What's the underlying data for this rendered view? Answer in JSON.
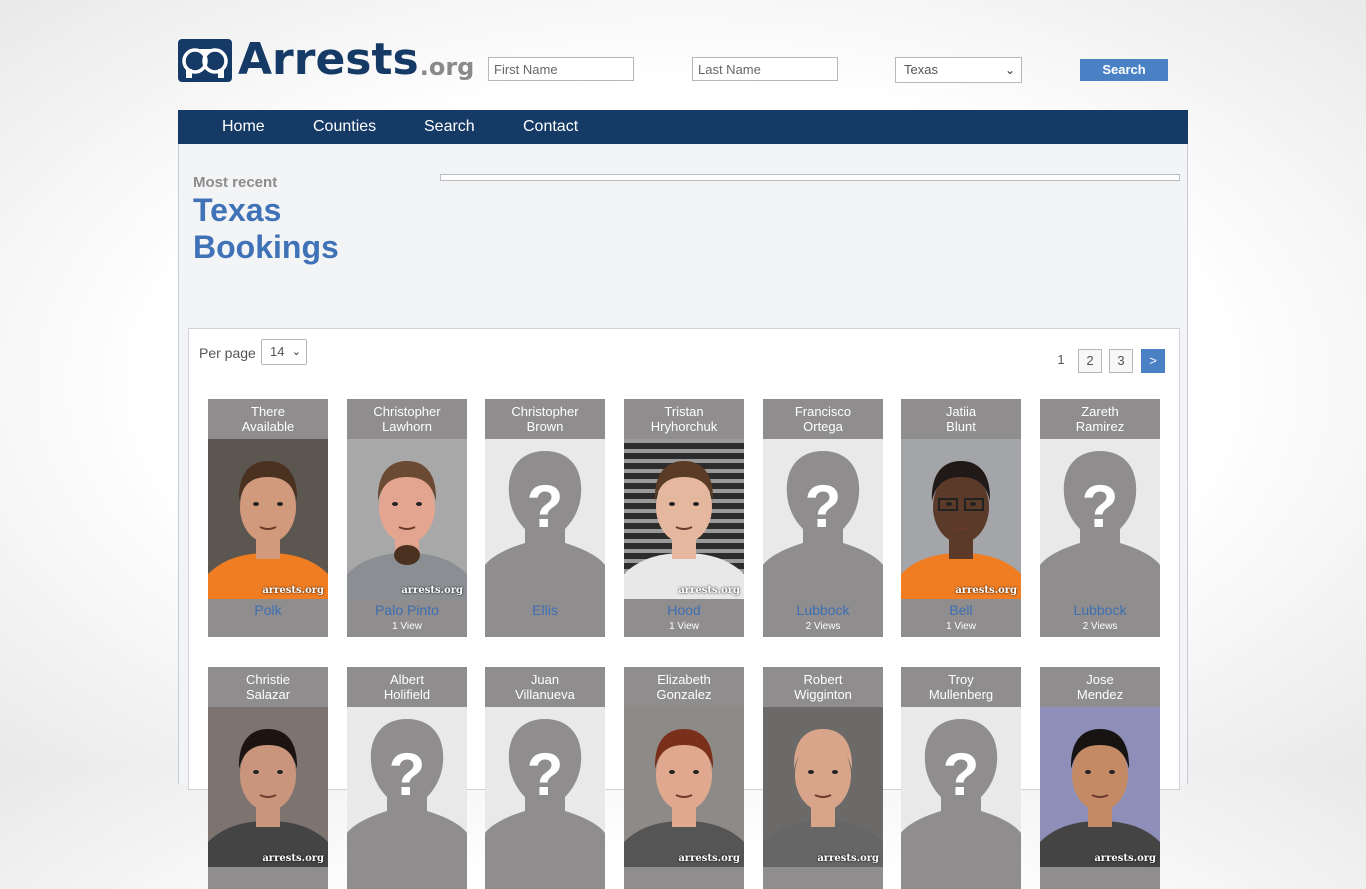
{
  "logo": {
    "name": "Arrests",
    "tld": ".org"
  },
  "search": {
    "first_placeholder": "First Name",
    "last_placeholder": "Last Name",
    "state": "Texas",
    "button": "Search"
  },
  "nav": {
    "items": [
      "Home",
      "Counties",
      "Search",
      "Contact"
    ]
  },
  "heading": {
    "kicker": "Most recent",
    "line1": "Texas",
    "line2": "Bookings"
  },
  "per_page": {
    "label": "Per page",
    "value": "14"
  },
  "pagination": {
    "current": "1",
    "pages": [
      "2",
      "3"
    ],
    "next": ">"
  },
  "watermark": "arrests.org",
  "cards": [
    {
      "first": "There",
      "last": "Available",
      "county": "Polk",
      "views": "",
      "photo": "man-brown-hair"
    },
    {
      "first": "Christopher",
      "last": "Lawhorn",
      "county": "Palo Pinto",
      "views": "1 View",
      "photo": "man-goatee"
    },
    {
      "first": "Christopher",
      "last": "Brown",
      "county": "Ellis",
      "views": "",
      "photo": "placeholder"
    },
    {
      "first": "Tristan",
      "last": "Hryhorchuk",
      "county": "Hood",
      "views": "1 View",
      "photo": "person-striped-bg"
    },
    {
      "first": "Francisco",
      "last": "Ortega",
      "county": "Lubbock",
      "views": "2 Views",
      "photo": "placeholder"
    },
    {
      "first": "Jatiia",
      "last": "Blunt",
      "county": "Bell",
      "views": "1 View",
      "photo": "woman-glasses"
    },
    {
      "first": "Zareth",
      "last": "Ramirez",
      "county": "Lubbock",
      "views": "2 Views",
      "photo": "placeholder"
    },
    {
      "first": "Christie",
      "last": "Salazar",
      "county": "",
      "views": "",
      "photo": "woman-dark-hair"
    },
    {
      "first": "Albert",
      "last": "Holifield",
      "county": "",
      "views": "",
      "photo": "placeholder"
    },
    {
      "first": "Juan",
      "last": "Villanueva",
      "county": "",
      "views": "",
      "photo": "placeholder"
    },
    {
      "first": "Elizabeth",
      "last": "Gonzalez",
      "county": "",
      "views": "",
      "photo": "woman-red-hair"
    },
    {
      "first": "Robert",
      "last": "Wigginton",
      "county": "",
      "views": "",
      "photo": "man-bald"
    },
    {
      "first": "Troy",
      "last": "Mullenberg",
      "county": "",
      "views": "",
      "photo": "placeholder"
    },
    {
      "first": "Jose",
      "last": "Mendez",
      "county": "",
      "views": "",
      "photo": "man-black-hair"
    }
  ]
}
